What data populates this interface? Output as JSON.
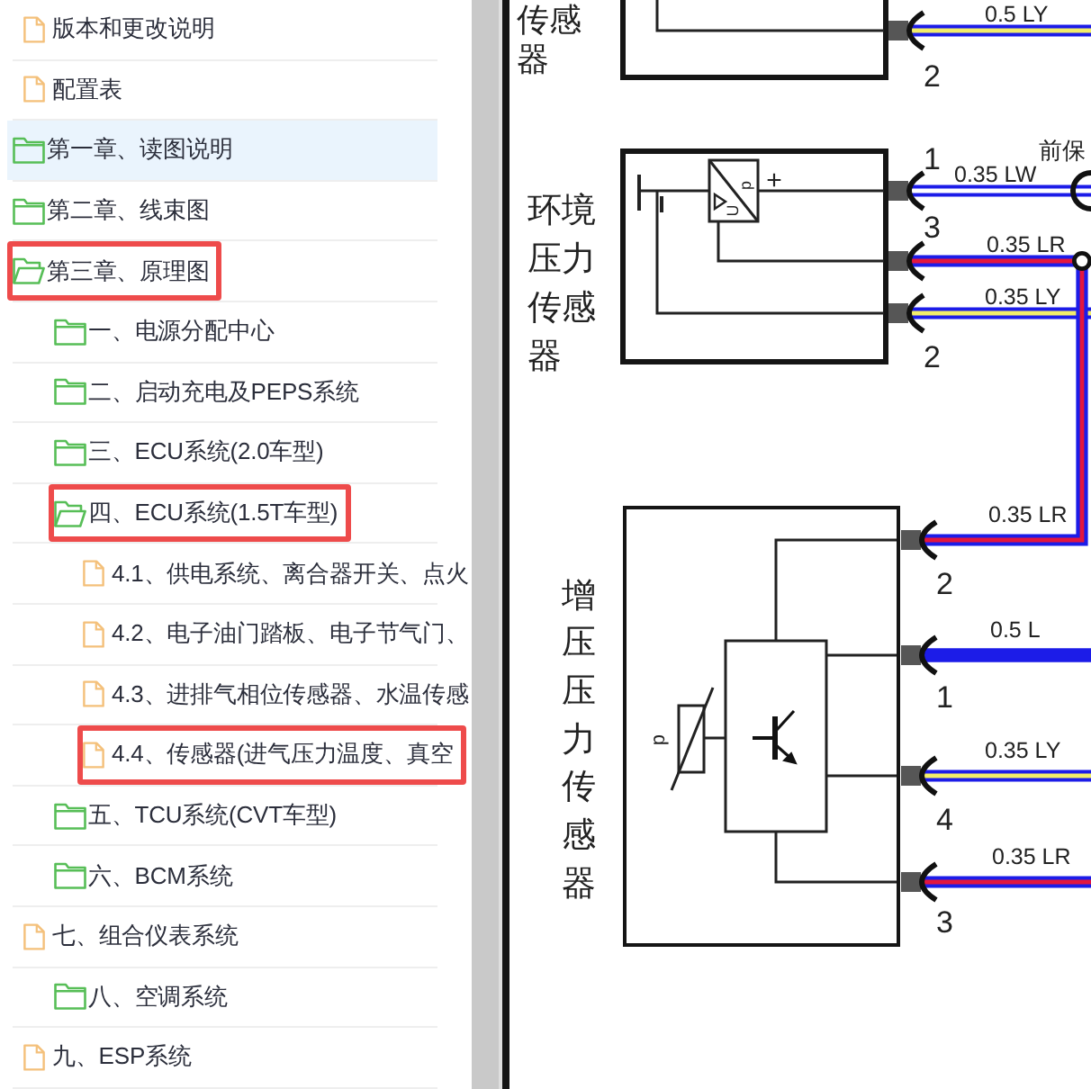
{
  "tree": [
    {
      "kind": "file",
      "label": "版本和更改说明",
      "selected": false,
      "marked": false
    },
    {
      "kind": "file",
      "label": "配置表",
      "selected": false,
      "marked": false
    },
    {
      "kind": "folder",
      "label": "第一章、读图说明",
      "expanded": false,
      "selected": true,
      "marked": false
    },
    {
      "kind": "folder",
      "label": "第二章、线束图",
      "expanded": false,
      "selected": false,
      "marked": false
    },
    {
      "kind": "folder",
      "label": "第三章、原理图",
      "expanded": true,
      "selected": false,
      "marked": true,
      "children": [
        {
          "kind": "folder",
          "label": "一、电源分配中心",
          "expanded": false,
          "selected": false,
          "marked": false
        },
        {
          "kind": "folder",
          "label": "二、启动充电及PEPS系统",
          "expanded": false,
          "selected": false,
          "marked": false
        },
        {
          "kind": "folder",
          "label": "三、ECU系统(2.0车型)",
          "expanded": false,
          "selected": false,
          "marked": false
        },
        {
          "kind": "folder",
          "label": "四、ECU系统(1.5T车型)",
          "expanded": true,
          "selected": false,
          "marked": true,
          "children": [
            {
              "kind": "file",
              "label": "4.1、供电系统、离合器开关、点火",
              "selected": false,
              "marked": false
            },
            {
              "kind": "file",
              "label": "4.2、电子油门踏板、电子节气门、",
              "selected": false,
              "marked": false
            },
            {
              "kind": "file",
              "label": "4.3、进排气相位传感器、水温传感",
              "selected": false,
              "marked": false
            },
            {
              "kind": "file",
              "label": "4.4、传感器(进气压力温度、真空",
              "selected": false,
              "marked": true
            }
          ]
        },
        {
          "kind": "folder",
          "label": "五、TCU系统(CVT车型)",
          "expanded": false,
          "selected": false,
          "marked": false
        },
        {
          "kind": "folder",
          "label": "六、BCM系统",
          "expanded": false,
          "selected": false,
          "marked": false
        }
      ]
    },
    {
      "kind": "file",
      "label": "七、组合仪表系统",
      "selected": false,
      "marked": false,
      "children": [
        {
          "kind": "folder",
          "label": "八、空调系统",
          "expanded": false,
          "selected": false,
          "marked": false
        }
      ]
    },
    {
      "kind": "file",
      "label": "九、ESP系统",
      "selected": false,
      "marked": false
    }
  ],
  "diagram": {
    "components": [
      {
        "kind": "plain",
        "name": "传感器",
        "pins": [
          {
            "number": "2",
            "wire": {
              "label": "0.5 LY",
              "color": "#1c1ce8",
              "stripe": {
                "color": "#f3ee6a"
              }
            }
          }
        ]
      },
      {
        "kind": "converter",
        "name": "环境压力传感器",
        "polarity": "+",
        "symbols": [
          "p",
          "U"
        ],
        "pins": [
          {
            "number": "1",
            "wire": {
              "label": "0.35 LW",
              "color": "#1c1ce8",
              "stripe": {
                "color": "#ffffff"
              },
              "destination": "前保"
            }
          },
          {
            "number": "3",
            "wire": {
              "label": "0.35 LR",
              "color": "#1c1ce8",
              "stripe": {
                "color": "#e3163e"
              }
            }
          },
          {
            "number": "2",
            "wire": {
              "label": "0.35 LY",
              "color": "#1c1ce8",
              "stripe": {
                "color": "#f3ee6a"
              }
            }
          }
        ]
      },
      {
        "kind": "transistor",
        "name": "增压压力传感器",
        "symbols": [
          "p"
        ],
        "pins": [
          {
            "number": "2",
            "wire": {
              "label": "0.35 LR",
              "color": "#1c1ce8",
              "stripe": {
                "color": "#e3163e"
              }
            }
          },
          {
            "number": "1",
            "wire": {
              "label": "0.5 L",
              "color": "#1c1ce8"
            }
          },
          {
            "number": "4",
            "wire": {
              "label": "0.35 LY",
              "color": "#1c1ce8",
              "stripe": {
                "color": "#f3ee6a"
              }
            }
          },
          {
            "number": "3",
            "wire": {
              "label": "0.35 LR",
              "color": "#1c1ce8",
              "stripe": {
                "color": "#e3163e"
              }
            }
          }
        ]
      }
    ]
  }
}
